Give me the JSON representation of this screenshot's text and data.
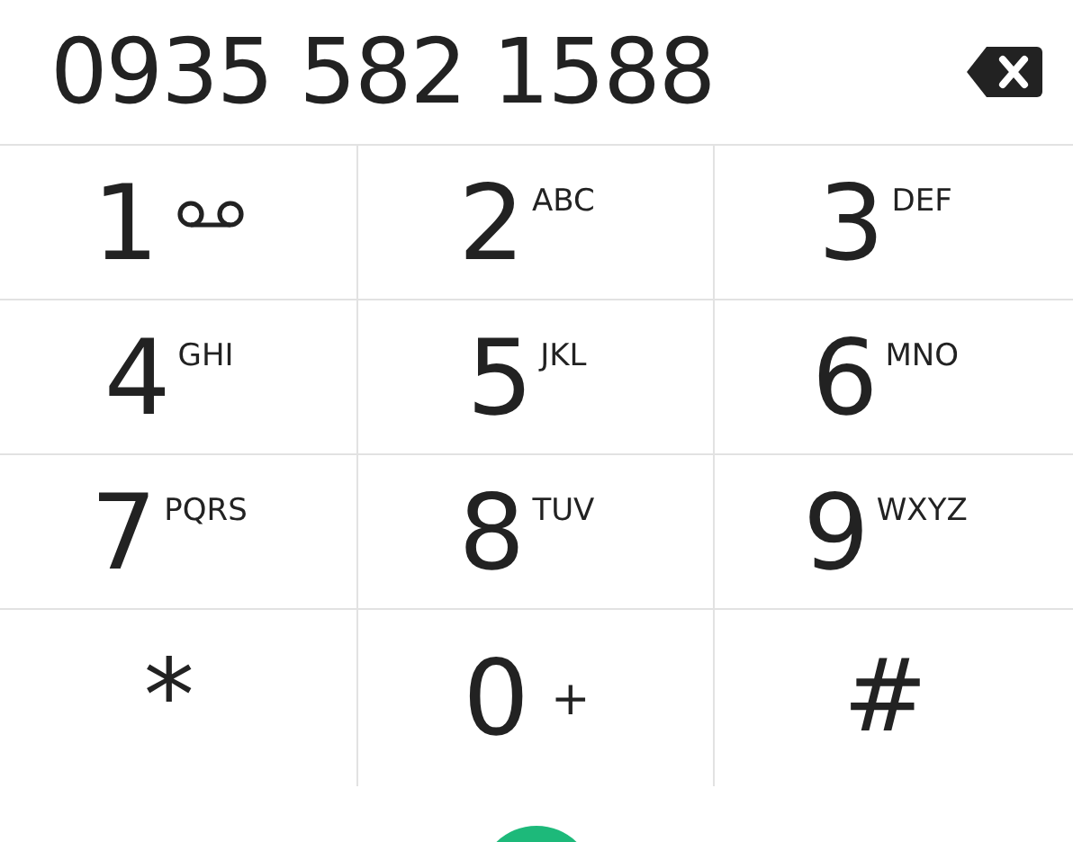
{
  "number": "0935 582 1588",
  "keys": [
    {
      "digit": "1",
      "kind": "voicemail"
    },
    {
      "digit": "2",
      "kind": "letters",
      "sub": "ABC"
    },
    {
      "digit": "3",
      "kind": "letters",
      "sub": "DEF"
    },
    {
      "digit": "4",
      "kind": "letters",
      "sub": "GHI"
    },
    {
      "digit": "5",
      "kind": "letters",
      "sub": "JKL"
    },
    {
      "digit": "6",
      "kind": "letters",
      "sub": "MNO"
    },
    {
      "digit": "7",
      "kind": "letters",
      "sub": "PQRS"
    },
    {
      "digit": "8",
      "kind": "letters",
      "sub": "TUV"
    },
    {
      "digit": "9",
      "kind": "letters",
      "sub": "WXYZ"
    },
    {
      "digit": "*",
      "kind": "symbol"
    },
    {
      "digit": "0",
      "kind": "plus",
      "sub": "+"
    },
    {
      "digit": "#",
      "kind": "symbol"
    }
  ]
}
